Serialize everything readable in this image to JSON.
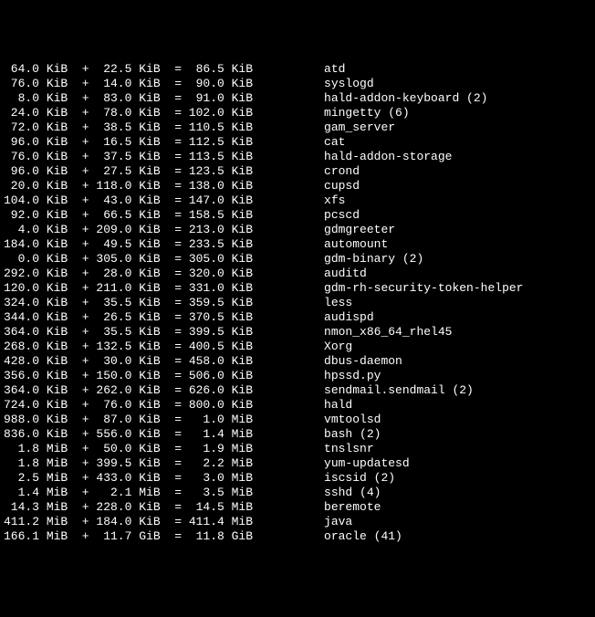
{
  "rows": [
    {
      "v1": "64.0",
      "u1": "KiB",
      "v2": "22.5",
      "u2": "KiB",
      "v3": "86.5",
      "u3": "KiB",
      "program": "atd"
    },
    {
      "v1": "76.0",
      "u1": "KiB",
      "v2": "14.0",
      "u2": "KiB",
      "v3": "90.0",
      "u3": "KiB",
      "program": "syslogd"
    },
    {
      "v1": "8.0",
      "u1": "KiB",
      "v2": "83.0",
      "u2": "KiB",
      "v3": "91.0",
      "u3": "KiB",
      "program": "hald-addon-keyboard (2)"
    },
    {
      "v1": "24.0",
      "u1": "KiB",
      "v2": "78.0",
      "u2": "KiB",
      "v3": "102.0",
      "u3": "KiB",
      "program": "mingetty (6)"
    },
    {
      "v1": "72.0",
      "u1": "KiB",
      "v2": "38.5",
      "u2": "KiB",
      "v3": "110.5",
      "u3": "KiB",
      "program": "gam_server"
    },
    {
      "v1": "96.0",
      "u1": "KiB",
      "v2": "16.5",
      "u2": "KiB",
      "v3": "112.5",
      "u3": "KiB",
      "program": "cat"
    },
    {
      "v1": "76.0",
      "u1": "KiB",
      "v2": "37.5",
      "u2": "KiB",
      "v3": "113.5",
      "u3": "KiB",
      "program": "hald-addon-storage"
    },
    {
      "v1": "96.0",
      "u1": "KiB",
      "v2": "27.5",
      "u2": "KiB",
      "v3": "123.5",
      "u3": "KiB",
      "program": "crond"
    },
    {
      "v1": "20.0",
      "u1": "KiB",
      "v2": "118.0",
      "u2": "KiB",
      "v3": "138.0",
      "u3": "KiB",
      "program": "cupsd"
    },
    {
      "v1": "104.0",
      "u1": "KiB",
      "v2": "43.0",
      "u2": "KiB",
      "v3": "147.0",
      "u3": "KiB",
      "program": "xfs"
    },
    {
      "v1": "92.0",
      "u1": "KiB",
      "v2": "66.5",
      "u2": "KiB",
      "v3": "158.5",
      "u3": "KiB",
      "program": "pcscd"
    },
    {
      "v1": "4.0",
      "u1": "KiB",
      "v2": "209.0",
      "u2": "KiB",
      "v3": "213.0",
      "u3": "KiB",
      "program": "gdmgreeter"
    },
    {
      "v1": "184.0",
      "u1": "KiB",
      "v2": "49.5",
      "u2": "KiB",
      "v3": "233.5",
      "u3": "KiB",
      "program": "automount"
    },
    {
      "v1": "0.0",
      "u1": "KiB",
      "v2": "305.0",
      "u2": "KiB",
      "v3": "305.0",
      "u3": "KiB",
      "program": "gdm-binary (2)"
    },
    {
      "v1": "292.0",
      "u1": "KiB",
      "v2": "28.0",
      "u2": "KiB",
      "v3": "320.0",
      "u3": "KiB",
      "program": "auditd"
    },
    {
      "v1": "120.0",
      "u1": "KiB",
      "v2": "211.0",
      "u2": "KiB",
      "v3": "331.0",
      "u3": "KiB",
      "program": "gdm-rh-security-token-helper"
    },
    {
      "v1": "324.0",
      "u1": "KiB",
      "v2": "35.5",
      "u2": "KiB",
      "v3": "359.5",
      "u3": "KiB",
      "program": "less"
    },
    {
      "v1": "344.0",
      "u1": "KiB",
      "v2": "26.5",
      "u2": "KiB",
      "v3": "370.5",
      "u3": "KiB",
      "program": "audispd"
    },
    {
      "v1": "364.0",
      "u1": "KiB",
      "v2": "35.5",
      "u2": "KiB",
      "v3": "399.5",
      "u3": "KiB",
      "program": "nmon_x86_64_rhel45"
    },
    {
      "v1": "268.0",
      "u1": "KiB",
      "v2": "132.5",
      "u2": "KiB",
      "v3": "400.5",
      "u3": "KiB",
      "program": "Xorg"
    },
    {
      "v1": "428.0",
      "u1": "KiB",
      "v2": "30.0",
      "u2": "KiB",
      "v3": "458.0",
      "u3": "KiB",
      "program": "dbus-daemon"
    },
    {
      "v1": "356.0",
      "u1": "KiB",
      "v2": "150.0",
      "u2": "KiB",
      "v3": "506.0",
      "u3": "KiB",
      "program": "hpssd.py"
    },
    {
      "v1": "364.0",
      "u1": "KiB",
      "v2": "262.0",
      "u2": "KiB",
      "v3": "626.0",
      "u3": "KiB",
      "program": "sendmail.sendmail (2)"
    },
    {
      "v1": "724.0",
      "u1": "KiB",
      "v2": "76.0",
      "u2": "KiB",
      "v3": "800.0",
      "u3": "KiB",
      "program": "hald"
    },
    {
      "v1": "988.0",
      "u1": "KiB",
      "v2": "87.0",
      "u2": "KiB",
      "v3": "1.0",
      "u3": "MiB",
      "program": "vmtoolsd"
    },
    {
      "v1": "836.0",
      "u1": "KiB",
      "v2": "556.0",
      "u2": "KiB",
      "v3": "1.4",
      "u3": "MiB",
      "program": "bash (2)"
    },
    {
      "v1": "1.8",
      "u1": "MiB",
      "v2": "50.0",
      "u2": "KiB",
      "v3": "1.9",
      "u3": "MiB",
      "program": "tnslsnr"
    },
    {
      "v1": "1.8",
      "u1": "MiB",
      "v2": "399.5",
      "u2": "KiB",
      "v3": "2.2",
      "u3": "MiB",
      "program": "yum-updatesd"
    },
    {
      "v1": "2.5",
      "u1": "MiB",
      "v2": "433.0",
      "u2": "KiB",
      "v3": "3.0",
      "u3": "MiB",
      "program": "iscsid (2)"
    },
    {
      "v1": "1.4",
      "u1": "MiB",
      "v2": "2.1",
      "u2": "MiB",
      "v3": "3.5",
      "u3": "MiB",
      "program": "sshd (4)"
    },
    {
      "v1": "14.3",
      "u1": "MiB",
      "v2": "228.0",
      "u2": "KiB",
      "v3": "14.5",
      "u3": "MiB",
      "program": "beremote"
    },
    {
      "v1": "411.2",
      "u1": "MiB",
      "v2": "184.0",
      "u2": "KiB",
      "v3": "411.4",
      "u3": "MiB",
      "program": "java"
    },
    {
      "v1": "166.1",
      "u1": "MiB",
      "v2": "11.7",
      "u2": "GiB",
      "v3": "11.8",
      "u3": "GiB",
      "program": "oracle (41)"
    }
  ]
}
